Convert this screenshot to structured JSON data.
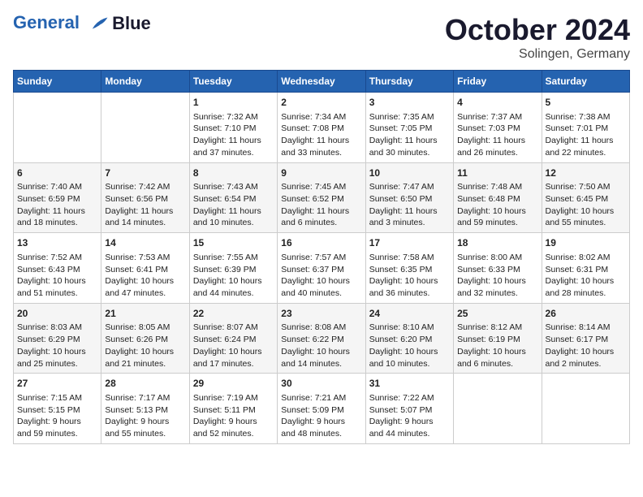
{
  "header": {
    "logo_line1": "General",
    "logo_line2": "Blue",
    "month": "October 2024",
    "location": "Solingen, Germany"
  },
  "days_of_week": [
    "Sunday",
    "Monday",
    "Tuesday",
    "Wednesday",
    "Thursday",
    "Friday",
    "Saturday"
  ],
  "weeks": [
    [
      {
        "day": "",
        "content": ""
      },
      {
        "day": "",
        "content": ""
      },
      {
        "day": "1",
        "content": "Sunrise: 7:32 AM\nSunset: 7:10 PM\nDaylight: 11 hours\nand 37 minutes."
      },
      {
        "day": "2",
        "content": "Sunrise: 7:34 AM\nSunset: 7:08 PM\nDaylight: 11 hours\nand 33 minutes."
      },
      {
        "day": "3",
        "content": "Sunrise: 7:35 AM\nSunset: 7:05 PM\nDaylight: 11 hours\nand 30 minutes."
      },
      {
        "day": "4",
        "content": "Sunrise: 7:37 AM\nSunset: 7:03 PM\nDaylight: 11 hours\nand 26 minutes."
      },
      {
        "day": "5",
        "content": "Sunrise: 7:38 AM\nSunset: 7:01 PM\nDaylight: 11 hours\nand 22 minutes."
      }
    ],
    [
      {
        "day": "6",
        "content": "Sunrise: 7:40 AM\nSunset: 6:59 PM\nDaylight: 11 hours\nand 18 minutes."
      },
      {
        "day": "7",
        "content": "Sunrise: 7:42 AM\nSunset: 6:56 PM\nDaylight: 11 hours\nand 14 minutes."
      },
      {
        "day": "8",
        "content": "Sunrise: 7:43 AM\nSunset: 6:54 PM\nDaylight: 11 hours\nand 10 minutes."
      },
      {
        "day": "9",
        "content": "Sunrise: 7:45 AM\nSunset: 6:52 PM\nDaylight: 11 hours\nand 6 minutes."
      },
      {
        "day": "10",
        "content": "Sunrise: 7:47 AM\nSunset: 6:50 PM\nDaylight: 11 hours\nand 3 minutes."
      },
      {
        "day": "11",
        "content": "Sunrise: 7:48 AM\nSunset: 6:48 PM\nDaylight: 10 hours\nand 59 minutes."
      },
      {
        "day": "12",
        "content": "Sunrise: 7:50 AM\nSunset: 6:45 PM\nDaylight: 10 hours\nand 55 minutes."
      }
    ],
    [
      {
        "day": "13",
        "content": "Sunrise: 7:52 AM\nSunset: 6:43 PM\nDaylight: 10 hours\nand 51 minutes."
      },
      {
        "day": "14",
        "content": "Sunrise: 7:53 AM\nSunset: 6:41 PM\nDaylight: 10 hours\nand 47 minutes."
      },
      {
        "day": "15",
        "content": "Sunrise: 7:55 AM\nSunset: 6:39 PM\nDaylight: 10 hours\nand 44 minutes."
      },
      {
        "day": "16",
        "content": "Sunrise: 7:57 AM\nSunset: 6:37 PM\nDaylight: 10 hours\nand 40 minutes."
      },
      {
        "day": "17",
        "content": "Sunrise: 7:58 AM\nSunset: 6:35 PM\nDaylight: 10 hours\nand 36 minutes."
      },
      {
        "day": "18",
        "content": "Sunrise: 8:00 AM\nSunset: 6:33 PM\nDaylight: 10 hours\nand 32 minutes."
      },
      {
        "day": "19",
        "content": "Sunrise: 8:02 AM\nSunset: 6:31 PM\nDaylight: 10 hours\nand 28 minutes."
      }
    ],
    [
      {
        "day": "20",
        "content": "Sunrise: 8:03 AM\nSunset: 6:29 PM\nDaylight: 10 hours\nand 25 minutes."
      },
      {
        "day": "21",
        "content": "Sunrise: 8:05 AM\nSunset: 6:26 PM\nDaylight: 10 hours\nand 21 minutes."
      },
      {
        "day": "22",
        "content": "Sunrise: 8:07 AM\nSunset: 6:24 PM\nDaylight: 10 hours\nand 17 minutes."
      },
      {
        "day": "23",
        "content": "Sunrise: 8:08 AM\nSunset: 6:22 PM\nDaylight: 10 hours\nand 14 minutes."
      },
      {
        "day": "24",
        "content": "Sunrise: 8:10 AM\nSunset: 6:20 PM\nDaylight: 10 hours\nand 10 minutes."
      },
      {
        "day": "25",
        "content": "Sunrise: 8:12 AM\nSunset: 6:19 PM\nDaylight: 10 hours\nand 6 minutes."
      },
      {
        "day": "26",
        "content": "Sunrise: 8:14 AM\nSunset: 6:17 PM\nDaylight: 10 hours\nand 2 minutes."
      }
    ],
    [
      {
        "day": "27",
        "content": "Sunrise: 7:15 AM\nSunset: 5:15 PM\nDaylight: 9 hours\nand 59 minutes."
      },
      {
        "day": "28",
        "content": "Sunrise: 7:17 AM\nSunset: 5:13 PM\nDaylight: 9 hours\nand 55 minutes."
      },
      {
        "day": "29",
        "content": "Sunrise: 7:19 AM\nSunset: 5:11 PM\nDaylight: 9 hours\nand 52 minutes."
      },
      {
        "day": "30",
        "content": "Sunrise: 7:21 AM\nSunset: 5:09 PM\nDaylight: 9 hours\nand 48 minutes."
      },
      {
        "day": "31",
        "content": "Sunrise: 7:22 AM\nSunset: 5:07 PM\nDaylight: 9 hours\nand 44 minutes."
      },
      {
        "day": "",
        "content": ""
      },
      {
        "day": "",
        "content": ""
      }
    ]
  ]
}
